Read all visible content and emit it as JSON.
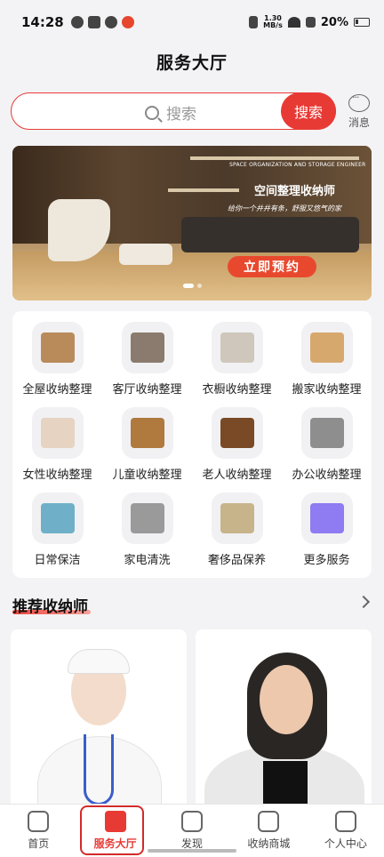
{
  "status_bar": {
    "time": "14:28",
    "net_speed_value": "1.30",
    "net_speed_unit": "MB/s",
    "battery": "20%"
  },
  "header": {
    "title": "服务大厅"
  },
  "search": {
    "placeholder": "搜索",
    "button_label": "搜索",
    "message_label": "消息"
  },
  "banner": {
    "english": "SPACE ORGANIZATION AND STORAGE ENGINEER",
    "title": "空间整理收纳师",
    "subtitle": "给你一个井井有条，舒服又悠气的家",
    "cta": "立即预约"
  },
  "services": [
    {
      "label": "全屋收纳整理",
      "icon": "house-icon",
      "color": "#b98a5a"
    },
    {
      "label": "客厅收纳整理",
      "icon": "armchair-icon",
      "color": "#8a7b6e"
    },
    {
      "label": "衣橱收纳整理",
      "icon": "wardrobe-icon",
      "color": "#cfc7bb"
    },
    {
      "label": "搬家收纳整理",
      "icon": "boxes-icon",
      "color": "#d7a86e"
    },
    {
      "label": "女性收纳整理",
      "icon": "shelf-icon",
      "color": "#e6d3c2"
    },
    {
      "label": "儿童收纳整理",
      "icon": "teddy-bear-icon",
      "color": "#b07a3e"
    },
    {
      "label": "老人收纳整理",
      "icon": "cane-icon",
      "color": "#7a4a26"
    },
    {
      "label": "办公收纳整理",
      "icon": "desk-icon",
      "color": "#8e8e8e"
    },
    {
      "label": "日常保洁",
      "icon": "cleaning-icon",
      "color": "#6fb0c8"
    },
    {
      "label": "家电清洗",
      "icon": "appliance-icon",
      "color": "#9a9a9a"
    },
    {
      "label": "奢侈品保养",
      "icon": "handbag-icon",
      "color": "#c8b48a"
    },
    {
      "label": "更多服务",
      "icon": "more-services-icon",
      "color": "#8f7bf2"
    }
  ],
  "recommend": {
    "title": "推荐收纳师"
  },
  "nav": [
    {
      "label": "首页",
      "icon": "home-icon"
    },
    {
      "label": "服务大厅",
      "icon": "service-hall-icon"
    },
    {
      "label": "发现",
      "icon": "planet-icon"
    },
    {
      "label": "收纳商城",
      "icon": "shopping-bag-icon"
    },
    {
      "label": "个人中心",
      "icon": "person-icon"
    }
  ]
}
